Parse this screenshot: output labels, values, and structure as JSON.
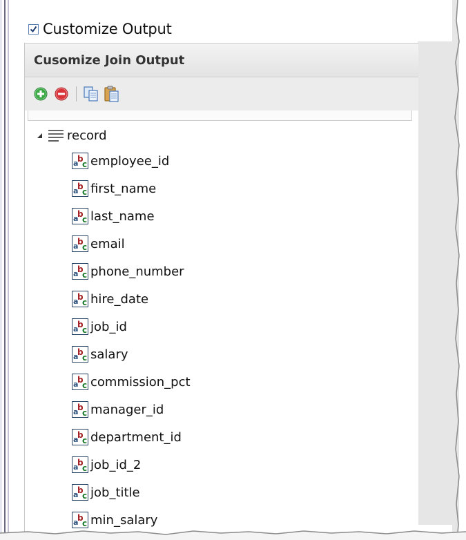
{
  "customize_output": {
    "label": "Customize Output",
    "checked": true
  },
  "panel": {
    "title": "Cusomize Join Output"
  },
  "toolbar": {
    "buttons": [
      {
        "name": "add-icon"
      },
      {
        "name": "remove-icon"
      },
      {
        "name": "copy-icon"
      },
      {
        "name": "paste-icon"
      }
    ]
  },
  "tree": {
    "root": {
      "label": "record",
      "expanded": true
    },
    "fields": [
      {
        "label": "employee_id"
      },
      {
        "label": "first_name"
      },
      {
        "label": "last_name"
      },
      {
        "label": "email"
      },
      {
        "label": "phone_number"
      },
      {
        "label": "hire_date"
      },
      {
        "label": "job_id"
      },
      {
        "label": "salary"
      },
      {
        "label": "commission_pct"
      },
      {
        "label": "manager_id"
      },
      {
        "label": "department_id"
      },
      {
        "label": "job_id_2"
      },
      {
        "label": "job_title"
      },
      {
        "label": "min_salary"
      }
    ]
  },
  "colors": {
    "add": "#3aa845",
    "remove": "#d9343a",
    "header_bg": "#e6e6e6"
  }
}
